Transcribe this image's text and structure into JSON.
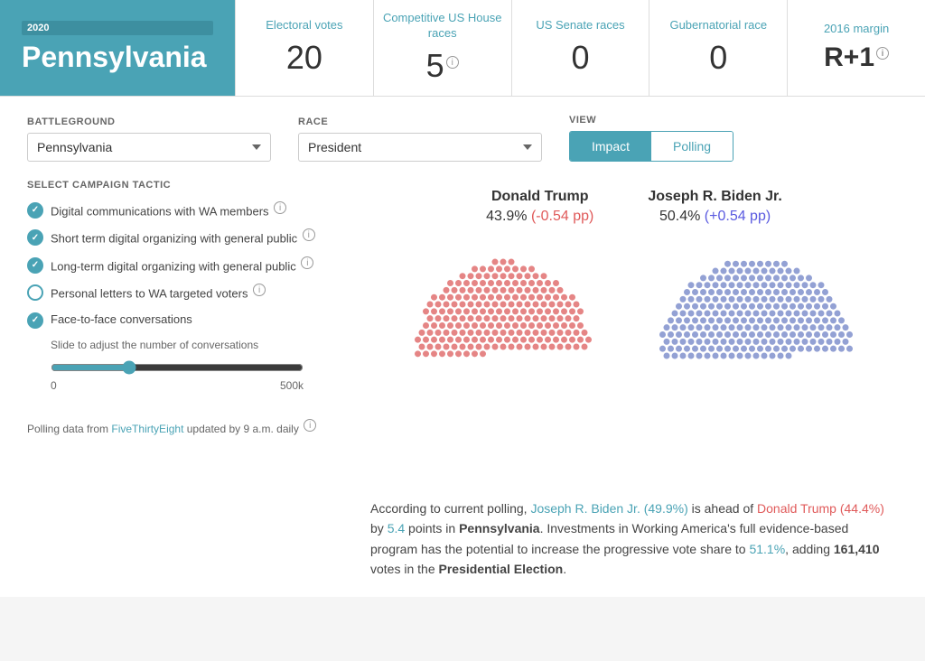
{
  "header": {
    "year": "2020",
    "state": "Pennsylvania",
    "stats": [
      {
        "label": "Electoral votes",
        "value": "20",
        "info": false
      },
      {
        "label": "Competitive US House races",
        "value": "5",
        "info": true
      },
      {
        "label": "US Senate races",
        "value": "0",
        "info": false
      },
      {
        "label": "Gubernatorial race",
        "value": "0",
        "info": false
      },
      {
        "label": "2016 margin",
        "value": "R+1",
        "info": true,
        "bold": true
      }
    ]
  },
  "controls": {
    "battleground_label": "BATTLEGROUND",
    "battleground_value": "Pennsylvania",
    "race_label": "RACE",
    "race_value": "President",
    "view_label": "VIEW",
    "view_impact": "Impact",
    "view_polling": "Polling"
  },
  "sidebar": {
    "section_title": "SELECT CAMPAIGN TACTIC",
    "tactics": [
      {
        "label": "Digital communications with WA members",
        "checked": true,
        "info": true
      },
      {
        "label": "Short term digital organizing with general public",
        "checked": true,
        "info": true
      },
      {
        "label": "Long-term digital organizing with general public",
        "checked": true,
        "info": true
      },
      {
        "label": "Personal letters to WA targeted voters",
        "checked": false,
        "info": true
      },
      {
        "label": "Face-to-face conversations",
        "checked": true,
        "info": false
      }
    ],
    "slider_desc": "Slide to adjust the number of conversations",
    "slider_min": "0",
    "slider_max": "500k",
    "polling_note_prefix": "Polling data from ",
    "polling_link": "FiveThirtyEight",
    "polling_note_suffix": " updated by 9 a.m. daily"
  },
  "candidates": [
    {
      "name": "Donald Trump",
      "pct": "43.9%",
      "change": "(-0.54 pp)",
      "change_type": "negative",
      "color": "#e05a5a"
    },
    {
      "name": "Joseph R. Biden Jr.",
      "pct": "50.4%",
      "change": "(+0.54 pp)",
      "change_type": "positive",
      "color": "#7a8fd4"
    }
  ],
  "description": {
    "text_parts": [
      "According to current polling, ",
      "Joseph R. Biden Jr. (49.9%)",
      " is ahead of ",
      "Donald Trump (44.4%)",
      " by ",
      "5.4",
      " points in ",
      "Pennsylvania",
      ". Investments in Working America's full evidence-based program has the potential to increase the progressive vote share to ",
      "51.1%",
      ", adding ",
      "161,410",
      " votes in the ",
      "Presidential Election",
      "."
    ]
  },
  "colors": {
    "teal": "#4aa3b5",
    "red": "#e05a5a",
    "blue": "#7a8fd4"
  }
}
